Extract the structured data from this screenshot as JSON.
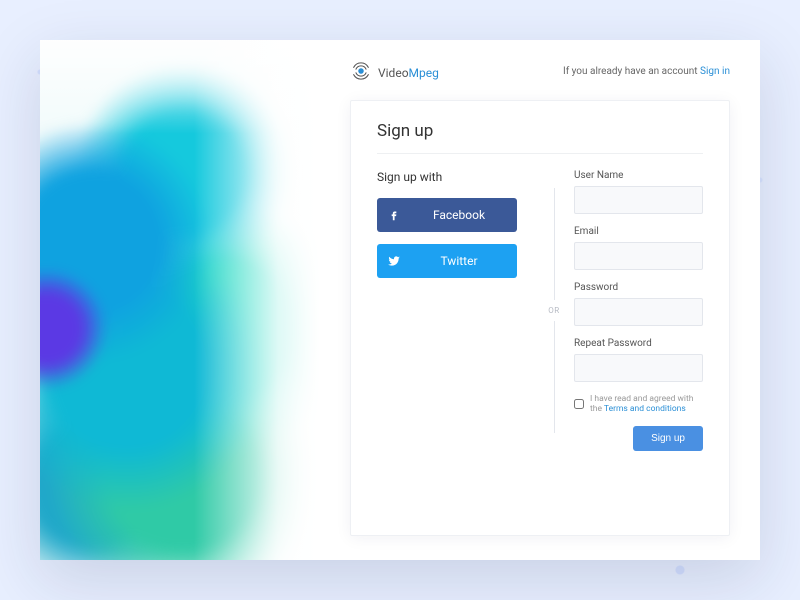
{
  "brand": {
    "name1": "Video",
    "name2": "Mpeg"
  },
  "topbar": {
    "existing_text": "If you already have an account ",
    "signin_link": "Sign in"
  },
  "card": {
    "title": "Sign up",
    "social_label": "Sign up with",
    "facebook_label": "Facebook",
    "twitter_label": "Twitter",
    "or_label": "OR",
    "fields": {
      "username": {
        "label": "User Name",
        "value": ""
      },
      "email": {
        "label": "Email",
        "value": ""
      },
      "password": {
        "label": "Password",
        "value": ""
      },
      "repeat": {
        "label": "Repeat Password",
        "value": ""
      }
    },
    "terms": {
      "prefix": "I have read and agreed with the ",
      "link": "Terms and conditions"
    },
    "submit_label": "Sign up"
  }
}
